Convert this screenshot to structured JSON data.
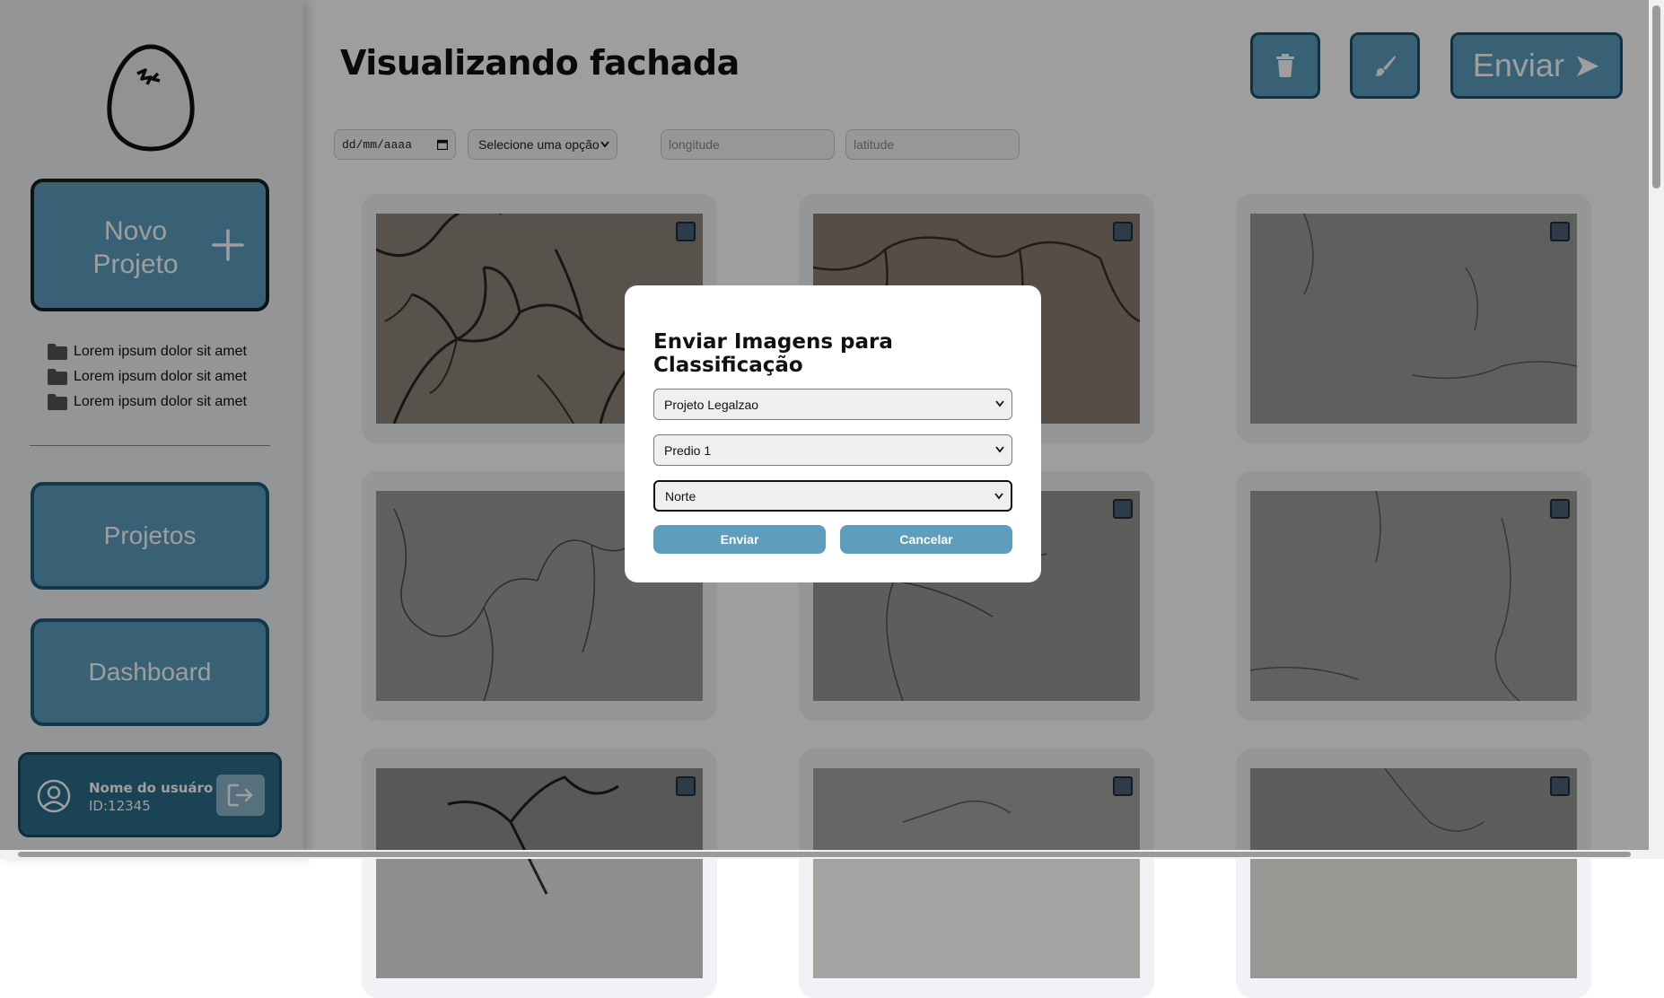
{
  "sidebar": {
    "new_project_label": "Novo Projeto",
    "folders": [
      {
        "label": "Lorem ipsum dolor sit amet",
        "icon": "folder-icon"
      },
      {
        "label": "Lorem ipsum dolor sit amet",
        "icon": "folder-icon"
      },
      {
        "label": "Lorem ipsum dolor sit amet",
        "icon": "folder-icon"
      }
    ],
    "nav": {
      "projects": "Projetos",
      "dashboard": "Dashboard"
    },
    "user": {
      "name": "Nome do usuáro",
      "id": "ID:12345"
    }
  },
  "header": {
    "title": "Visualizando fachada",
    "send_label": "Enviar ➤"
  },
  "filters": {
    "date_placeholder": "dd/mm/aaaa",
    "select_value": "Selecione uma opção",
    "longitude_placeholder": "longitude",
    "latitude_placeholder": "latitude"
  },
  "modal": {
    "title": "Enviar Imagens para Classificação",
    "project_value": "Projeto Legalzao",
    "building_value": "Predio 1",
    "facade_value": "Norte",
    "send_label": "Enviar",
    "cancel_label": "Cancelar"
  },
  "colors": {
    "accent": "#5d9dbf",
    "accent_dark": "#1e5c7a",
    "user_card": "#2a6d8c"
  }
}
